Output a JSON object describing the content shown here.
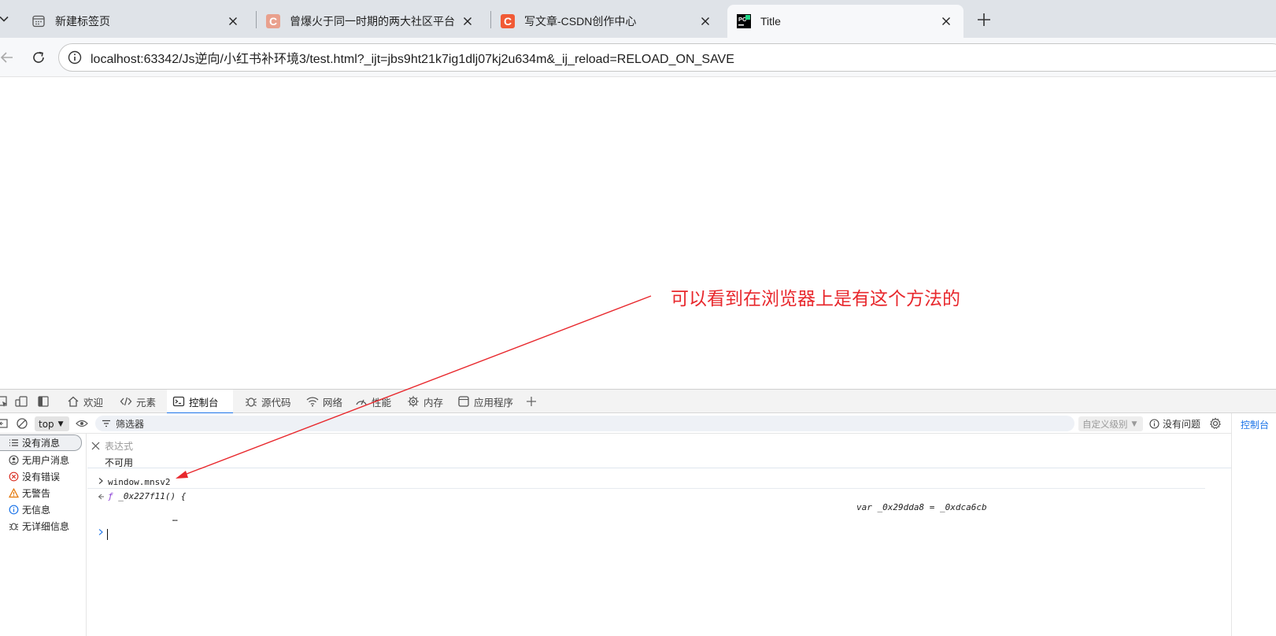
{
  "browser": {
    "tabs": [
      {
        "title": "新建标签页",
        "favicon": "new-tab-page-icon",
        "active": false
      },
      {
        "title": "曾爆火于同一时期的两大社区平台",
        "favicon": "csdn-icon",
        "active": false
      },
      {
        "title": "写文章-CSDN创作中心",
        "favicon": "csdn-icon",
        "active": false
      },
      {
        "title": "Title",
        "favicon": "pycharm-icon",
        "active": true
      }
    ],
    "url": "localhost:63342/Js逆向/小红书补环境3/test.html?_ijt=jbs9ht21k7ig1dlj07kj2u634m&_ij_reload=RELOAD_ON_SAVE"
  },
  "annotation": {
    "text": "可以看到在浏览器上是有这个方法的",
    "color": "#e8282d"
  },
  "devtools": {
    "tabs": [
      {
        "label": "欢迎",
        "icon": "home-icon"
      },
      {
        "label": "元素",
        "icon": "code-icon"
      },
      {
        "label": "控制台",
        "icon": "console-icon",
        "active": true
      },
      {
        "label": "源代码",
        "icon": "bug-icon"
      },
      {
        "label": "网络",
        "icon": "wifi-icon"
      },
      {
        "label": "性能",
        "icon": "gauge-icon"
      },
      {
        "label": "内存",
        "icon": "memory-icon"
      },
      {
        "label": "应用程序",
        "icon": "app-icon"
      }
    ],
    "toolbar": {
      "context": "top",
      "filter_placeholder": "筛选器",
      "levels": "自定义级别",
      "issues": "没有问题"
    },
    "right_panel": "控制台",
    "sidebar": [
      {
        "label": "没有消息",
        "icon": "list-icon"
      },
      {
        "label": "无用户消息",
        "icon": "user-icon"
      },
      {
        "label": "没有错误",
        "icon": "error-icon"
      },
      {
        "label": "无警告",
        "icon": "warning-icon"
      },
      {
        "label": "无信息",
        "icon": "info-icon"
      },
      {
        "label": "无详细信息",
        "icon": "verbose-icon"
      }
    ],
    "console": {
      "expression_placeholder": "表达式",
      "expression_result": "不可用",
      "command": "window.mnsv2",
      "result_f": "ƒ",
      "result_name": "_0x227f11() {",
      "result_body": "var _0x29dda8 = _0xdca6cb",
      "ellipsis": "…"
    }
  }
}
